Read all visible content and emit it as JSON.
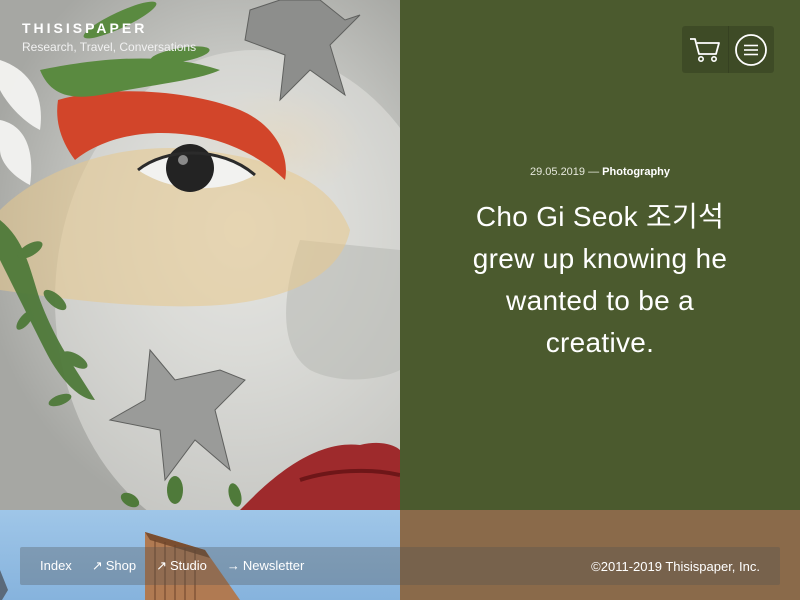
{
  "brand": {
    "name": "THISISPAPER",
    "tagline": "Research, Travel, Conversations"
  },
  "header": {
    "cart_icon": "cart-icon",
    "menu_icon": "menu-icon"
  },
  "article": {
    "date": "29.05.2019",
    "separator": "—",
    "category": "Photography",
    "headline": "Cho Gi Seok 조기석 grew up knowing he wanted to be a creative."
  },
  "footer": {
    "nav": [
      {
        "label": "Index",
        "arrow": ""
      },
      {
        "label": "Shop",
        "arrow": "↗"
      },
      {
        "label": "Studio",
        "arrow": "↗"
      },
      {
        "label": "Newsletter",
        "arrow": "→"
      }
    ],
    "copyright": "©2011-2019 Thisispaper, Inc."
  },
  "colors": {
    "olive_panel": "#4b5a2e",
    "brown_panel": "#8a6a4a",
    "sky": "#9fc6e8"
  }
}
